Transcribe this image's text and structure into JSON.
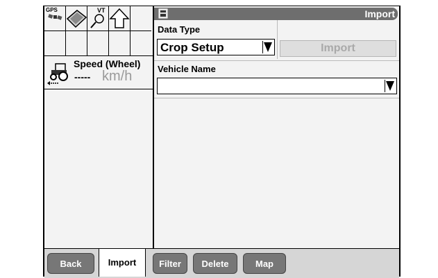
{
  "status_icons": {
    "gps_label": "GPS",
    "vt_label": "VT",
    "icons": [
      "satellite-icon",
      "field-map-icon",
      "magnifier-icon",
      "up-arrow-icon"
    ]
  },
  "speed": {
    "title": "Speed (Wheel)",
    "value": "-----",
    "unit": "km/h"
  },
  "header": {
    "title": "Import"
  },
  "data_type": {
    "label": "Data Type",
    "selected": "Crop Setup"
  },
  "import_button": {
    "label": "Import",
    "enabled": false
  },
  "vehicle": {
    "label": "Vehicle Name",
    "selected": ""
  },
  "tabs": {
    "back": "Back",
    "import": "Import",
    "filter": "Filter",
    "delete": "Delete",
    "map": "Map"
  },
  "colors": {
    "title_bar": "#6e6e6e",
    "tab_button": "#777777",
    "disabled_text": "#a9a9a9"
  }
}
